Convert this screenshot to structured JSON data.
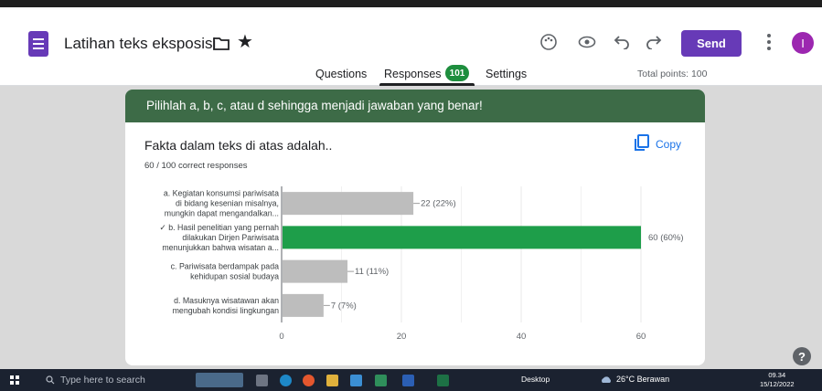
{
  "header": {
    "doc_title": "Latihan teks eksposisi",
    "send_label": "Send",
    "avatar_initial": "I",
    "accent": "#673ab7"
  },
  "tabs": {
    "questions": "Questions",
    "responses": "Responses",
    "responses_count": "101",
    "settings": "Settings",
    "total_points": "Total points: 100"
  },
  "section": {
    "banner": "Pilihlah a, b, c, atau d sehingga menjadi jawaban yang benar!",
    "color": "#3d6b47"
  },
  "question": {
    "title": "Fakta dalam teks di atas adalah..",
    "subtitle": "60 / 100 correct responses",
    "copy_label": "Copy"
  },
  "chart_data": {
    "type": "bar",
    "orientation": "horizontal",
    "categories": [
      [
        "a. Kegiatan konsumsi pariwisata",
        "di bidang kesenian misalnya,",
        "mungkin dapat mengandalkan..."
      ],
      [
        "✓ b. Hasil penelitian yang pernah",
        "dilakukan Dirjen Pariwisata",
        "menunjukkan bahwa wisatan a..."
      ],
      [
        "c. Pariwisata berdampak pada",
        "kehidupan sosial budaya"
      ],
      [
        "d. Masuknya wisatawan akan",
        "mengubah kondisi lingkungan"
      ]
    ],
    "values": [
      22,
      60,
      11,
      7
    ],
    "data_labels": [
      "22 (22%)",
      "60 (60%)",
      "11 (11%)",
      "7 (7%)"
    ],
    "correct_index": 1,
    "xlim": [
      0,
      60
    ],
    "xticks": [
      "0",
      "20",
      "40",
      "60"
    ],
    "grid": true,
    "colors": {
      "default": "#bdbdbd",
      "correct": "#1e9e4a"
    }
  },
  "taskbar": {
    "search_placeholder": "Type here to search",
    "desktop_label": "Desktop",
    "weather": "26°C  Berawan",
    "time": "09.34",
    "date": "15/12/2022"
  }
}
